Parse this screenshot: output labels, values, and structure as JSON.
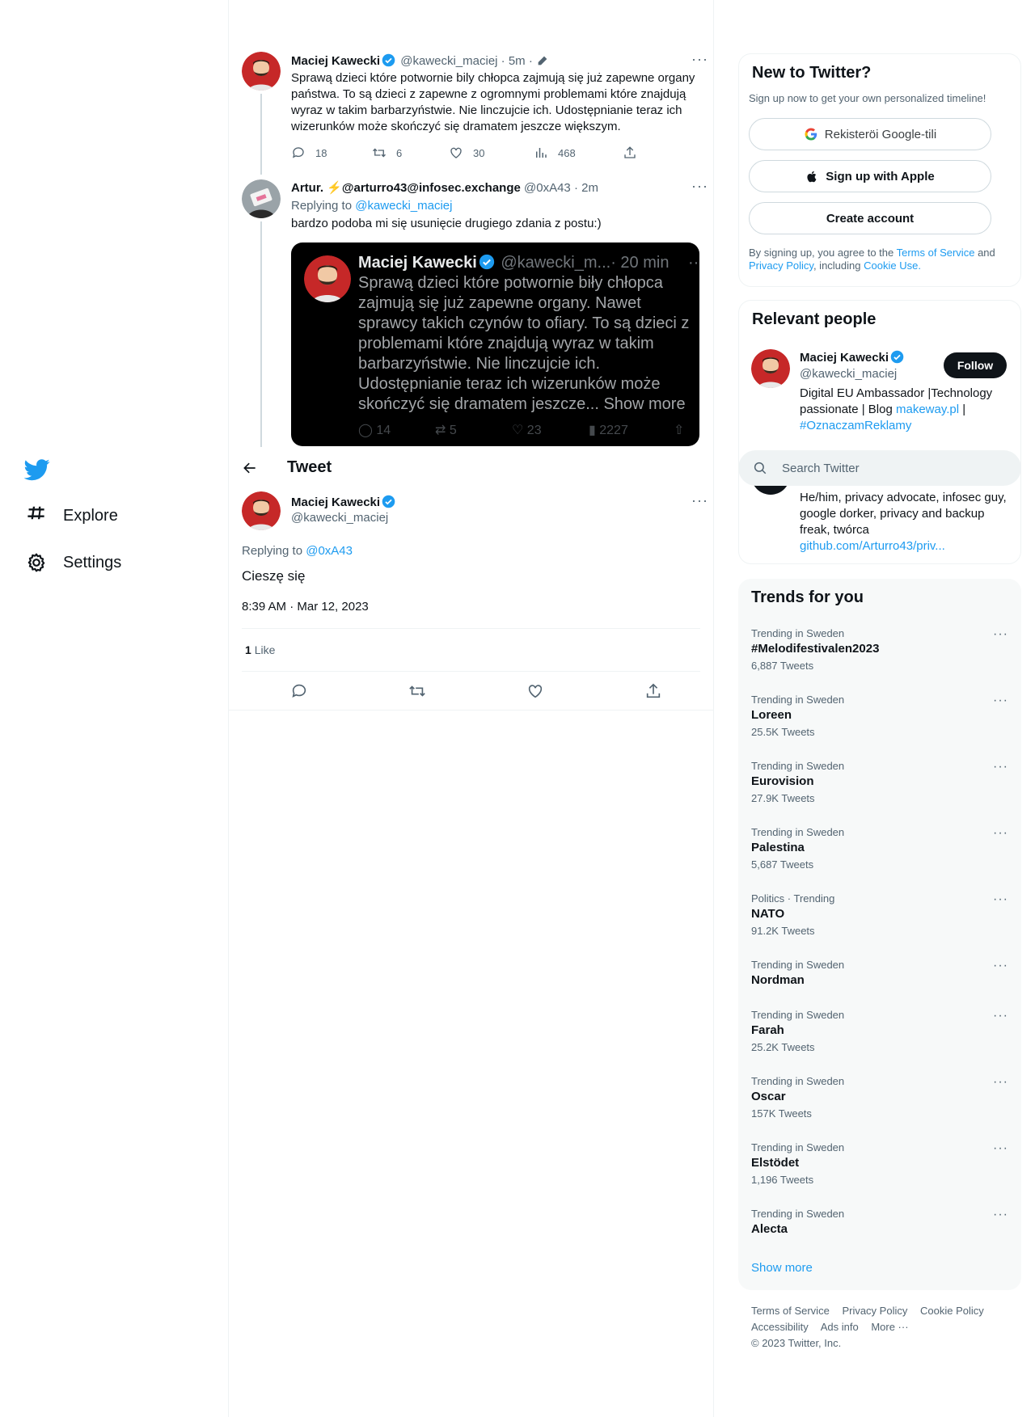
{
  "nav": {
    "logo": "twitter-bird",
    "explore_label": "Explore",
    "settings_label": "Settings"
  },
  "thread": {
    "tweet1": {
      "name": "Maciej Kawecki",
      "handle": "@kawecki_maciej",
      "meta": "· 5m ·",
      "text": "Sprawą dzieci które potwornie bily chłopca zajmują się już zapewne organy państwa. To są dzieci z zapewne z ogromnymi problemami które znajdują wyraz w takim barbarzyństwie. Nie linczujcie ich. Udostępnianie teraz ich wizerunków może skończyć się dramatem jeszcze większym.",
      "replies": "18",
      "retweets": "6",
      "likes": "30",
      "views": "468"
    },
    "tweet2": {
      "name": "Artur. ⚡@arturro43@infosec.exchange",
      "handle": "@0xA43",
      "meta": "· 2m",
      "replying_prefix": "Replying to",
      "replying_to": "@kawecki_maciej",
      "text": "bardzo podoba mi się usunięcie drugiego zdania z postu:)",
      "embed": {
        "name": "Maciej Kawecki",
        "handle": "@kawecki_m...",
        "time": "· 20 min",
        "text": "Sprawą dzieci które potwornie biły chłopca zajmują się już zapewne organy. Nawet sprawcy takich czynów to ofiary. To są dzieci z problemami które znajdują wyraz w takim barbarzyństwie. Nie linczujcie ich. Udostępnianie teraz ich wizerunków może skończyć się dramatem jeszcze...",
        "show_more": "Show more",
        "replies": "14",
        "retweets": "5",
        "likes": "23",
        "views": "2227"
      }
    }
  },
  "header": {
    "title": "Tweet"
  },
  "main_tweet": {
    "name": "Maciej Kawecki",
    "handle": "@kawecki_maciej",
    "replying_prefix": "Replying to",
    "replying_to": "@0xA43",
    "text": "Cieszę się",
    "timestamp": "8:39 AM · Mar 12, 2023",
    "likes_count": "1",
    "likes_label": "Like"
  },
  "signup": {
    "title": "New to Twitter?",
    "subtitle": "Sign up now to get your own personalized timeline!",
    "google_label": "Rekisteröi Google-tili",
    "apple_label": "Sign up with Apple",
    "create_label": "Create account",
    "legal_1": "By signing up, you agree to the",
    "terms": "Terms of Service",
    "and": "and",
    "privacy": "Privacy Policy",
    "including": ", including",
    "cookie": "Cookie Use."
  },
  "relevant": {
    "title": "Relevant people",
    "person1": {
      "name": "Maciej Kawecki",
      "handle": "@kawecki_maciej",
      "follow_label": "Follow",
      "bio_1": "Digital EU Ambassador |Technology passionate | Blog",
      "bio_link1": "makeway.pl",
      "bio_sep": "|",
      "bio_link2": "#OznaczamReklamy"
    },
    "person2": {
      "bio": "He/him, privacy advocate, infosec guy, google dorker, privacy and backup freak, twórca",
      "link": "github.com/Arturro43/priv..."
    }
  },
  "search": {
    "placeholder": "Search Twitter"
  },
  "trends": {
    "title": "Trends for you",
    "items": [
      {
        "context": "Trending in Sweden",
        "name": "#Melodifestivalen2023",
        "count": "6,887 Tweets"
      },
      {
        "context": "Trending in Sweden",
        "name": "Loreen",
        "count": "25.5K Tweets"
      },
      {
        "context": "Trending in Sweden",
        "name": "Eurovision",
        "count": "27.9K Tweets"
      },
      {
        "context": "Trending in Sweden",
        "name": "Palestina",
        "count": "5,687 Tweets"
      },
      {
        "context": "Politics · Trending",
        "name": "NATO",
        "count": "91.2K Tweets"
      },
      {
        "context": "Trending in Sweden",
        "name": "Nordman",
        "count": ""
      },
      {
        "context": "Trending in Sweden",
        "name": "Farah",
        "count": "25.2K Tweets"
      },
      {
        "context": "Trending in Sweden",
        "name": "Oscar",
        "count": "157K Tweets"
      },
      {
        "context": "Trending in Sweden",
        "name": "Elstödet",
        "count": "1,196 Tweets"
      },
      {
        "context": "Trending in Sweden",
        "name": "Alecta",
        "count": ""
      }
    ],
    "show_more": "Show more"
  },
  "footer": {
    "links": [
      "Terms of Service",
      "Privacy Policy",
      "Cookie Policy",
      "Accessibility",
      "Ads info",
      "More ···"
    ],
    "copyright": "© 2023 Twitter, Inc."
  },
  "colors": {
    "accent": "#1d9bf0",
    "text": "#0f1419",
    "muted": "#536471",
    "border": "#eff3f4"
  }
}
